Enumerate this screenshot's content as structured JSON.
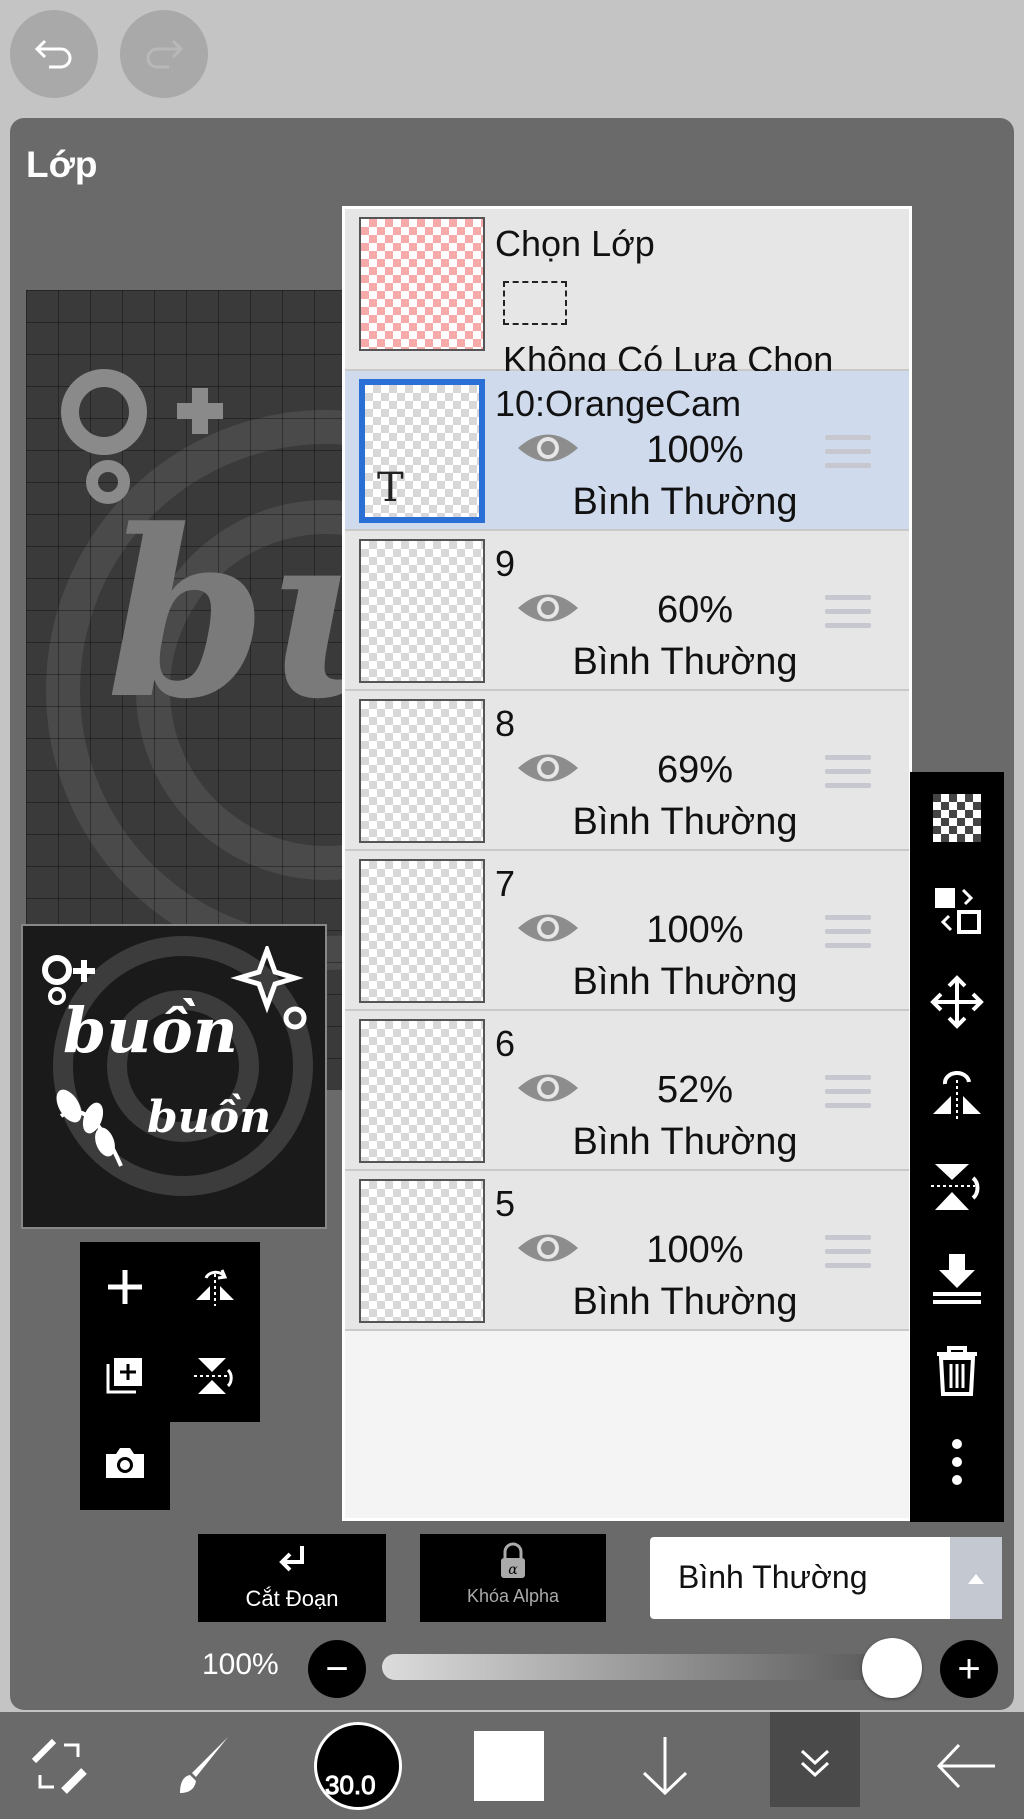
{
  "panel": {
    "title": "Lớp"
  },
  "selection_layer": {
    "title": "Chọn Lớp",
    "status": "Không Có Lựa Chọn"
  },
  "layers": [
    {
      "name": "10:OrangeCam",
      "opacity": "100%",
      "blend": "Bình Thường",
      "selected": true,
      "type": "text",
      "type_mark": "T"
    },
    {
      "name": "9",
      "opacity": "60%",
      "blend": "Bình Thường",
      "selected": false
    },
    {
      "name": "8",
      "opacity": "69%",
      "blend": "Bình Thường",
      "selected": false
    },
    {
      "name": "7",
      "opacity": "100%",
      "blend": "Bình Thường",
      "selected": false
    },
    {
      "name": "6",
      "opacity": "52%",
      "blend": "Bình Thường",
      "selected": false
    },
    {
      "name": "5",
      "opacity": "100%",
      "blend": "Bình Thường",
      "selected": false
    }
  ],
  "canvas_art": {
    "big_word": "bu",
    "word": "buồn",
    "word_small": "buồn"
  },
  "bottom_controls": {
    "clip_label": "Cắt Đoạn",
    "alpha_lock_label": "Khóa Alpha",
    "blend_mode": "Bình Thường",
    "opacity_label": "100%",
    "opacity_value": 1.0
  },
  "toolbar": {
    "brush_size": "30.0"
  },
  "colors": {
    "selected_row": "#cfdaec",
    "selection_border": "#2a6fd6",
    "panel": "#6a6a6a"
  }
}
